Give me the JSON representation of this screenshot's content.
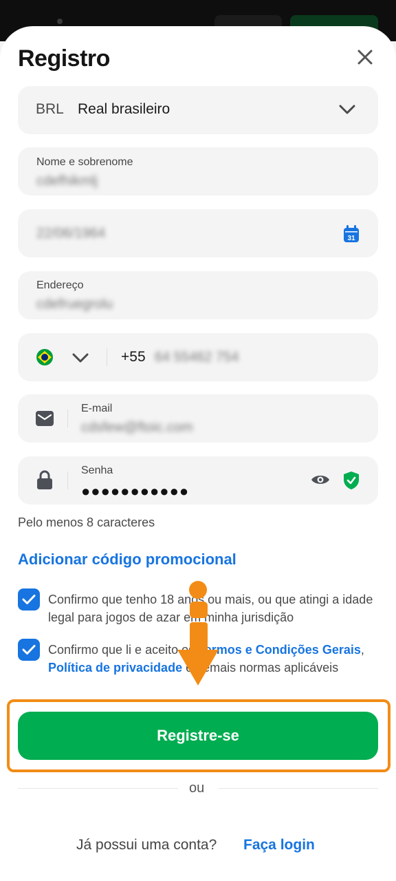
{
  "header": {
    "title": "Registro"
  },
  "currency": {
    "code": "BRL",
    "name": "Real brasileiro"
  },
  "fields": {
    "name": {
      "label": "Nome e sobrenome",
      "value": "cdefhikmlj"
    },
    "birthdate": {
      "value": "22/06/1964",
      "calendar_day": "31"
    },
    "address": {
      "label": "Endereço",
      "value": "cdefruegrolu"
    },
    "phone": {
      "country_code": "+55",
      "number": "64 55462 754"
    },
    "email": {
      "label": "E-mail",
      "value": "cdsfew@ftoic.com"
    },
    "password": {
      "label": "Senha",
      "value": "●●●●●●●●●●●"
    }
  },
  "password_hint": "Pelo menos 8 caracteres",
  "promo_link": "Adicionar código promocional",
  "checkboxes": [
    {
      "text": "Confirmo que tenho 18 anos ou mais, ou que atingi a idade legal para jogos de azar em minha jurisdição",
      "checked": true
    },
    {
      "text_before": "Confirmo que li e aceito os ",
      "link1": "Termos e Condições Gerais",
      "comma": ", ",
      "link2": "Política de privacidade",
      "text_after": " e demais normas aplicáveis",
      "checked": true
    }
  ],
  "register_button": "Registre-se",
  "or_text": "ou",
  "login": {
    "question": "Já possui uma conta?",
    "link": "Faça login"
  },
  "colors": {
    "accent_blue": "#1774e0",
    "register_green": "#00ad50",
    "annotation_orange": "#f28c16"
  }
}
